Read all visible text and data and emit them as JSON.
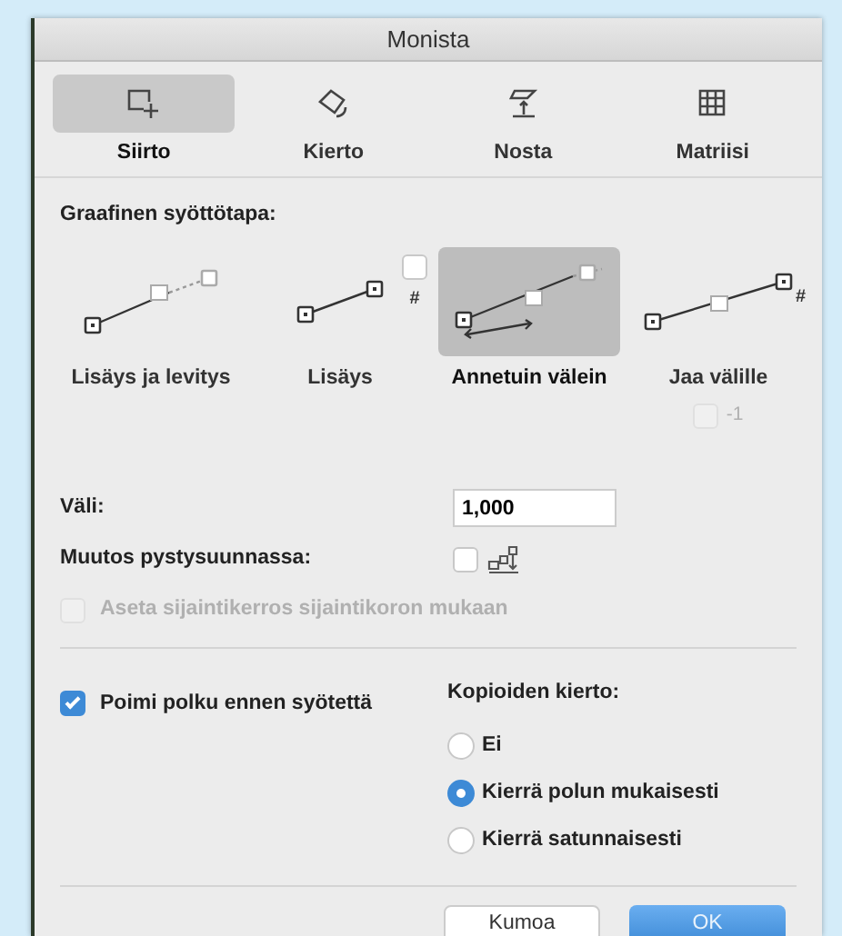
{
  "window": {
    "title": "Monista"
  },
  "tabs": [
    {
      "label": "Siirto",
      "kind": "move",
      "selected": true
    },
    {
      "label": "Kierto",
      "kind": "rotate",
      "selected": false
    },
    {
      "label": "Nosta",
      "kind": "raise",
      "selected": false
    },
    {
      "label": "Matriisi",
      "kind": "matrix",
      "selected": false
    }
  ],
  "input_method": {
    "title": "Graafinen syöttötapa:",
    "methods": [
      {
        "label": "Lisäys ja levitys",
        "kind": "spread",
        "selected": false
      },
      {
        "label": "Lisäys",
        "kind": "increment",
        "selected": false,
        "count_mark": "#",
        "count_checkbox": {
          "checked": false
        }
      },
      {
        "label": "Annetuin välein",
        "kind": "distance",
        "selected": true
      },
      {
        "label": "Jaa välille",
        "kind": "divide",
        "selected": false,
        "count_mark": "#",
        "minus_one": {
          "label": "-1",
          "checked": false,
          "disabled": true
        }
      }
    ]
  },
  "spacing": {
    "label": "Väli:",
    "value": "1,000"
  },
  "vertical_change": {
    "label": "Muutos pystysuunnassa:",
    "checked": false
  },
  "story_option": {
    "label": "Aseta sijaintikerros sijaintikoron mukaan",
    "checked": false,
    "disabled": true
  },
  "pick_path": {
    "label": "Poimi polku ennen syötettä",
    "checked": true
  },
  "copy_rotation": {
    "title": "Kopioiden kierto:",
    "options": [
      {
        "label": "Ei",
        "selected": false
      },
      {
        "label": "Kierrä polun mukaisesti",
        "selected": true
      },
      {
        "label": "Kierrä satunnaisesti",
        "selected": false
      }
    ]
  },
  "buttons": [
    {
      "label": "Kumoa",
      "kind": "cancel"
    },
    {
      "label": "OK",
      "kind": "default"
    }
  ]
}
